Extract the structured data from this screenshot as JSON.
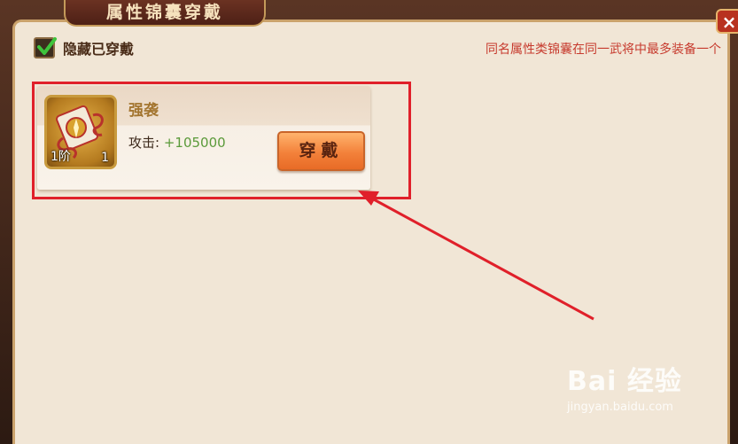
{
  "title": "属性锦囊穿戴",
  "close_icon": "×",
  "hide_equipped": {
    "label": "隐藏已穿戴",
    "checked": true
  },
  "hint": "同名属性类锦囊在同一武将中最多装备一个",
  "item": {
    "name": "强袭",
    "grade": "1阶",
    "count": "1",
    "stat_label": "攻击:",
    "stat_value": "+105000",
    "equip_label": "穿戴"
  },
  "watermark": {
    "logo": "Bai  经验",
    "site": "jingyan.baidu.com"
  },
  "colors": {
    "panel_bg": "#f1e6d6",
    "title_bg": "#6b3222",
    "hint": "#c73b2e",
    "item_name": "#a3752f",
    "stat_value": "#5b9a3a",
    "equip_button": "#f3813a",
    "annotation": "#e0202a"
  }
}
